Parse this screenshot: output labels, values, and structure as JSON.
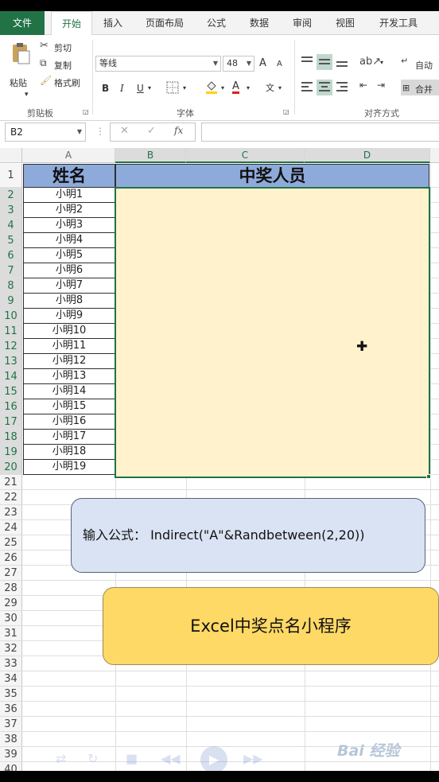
{
  "tabs": [
    "文件",
    "开始",
    "插入",
    "页面布局",
    "公式",
    "数据",
    "审阅",
    "视图",
    "开发工具"
  ],
  "ribbon": {
    "paste": "粘贴",
    "cut": "剪切",
    "copy": "复制",
    "format_painter": "格式刷",
    "clipboard_group": "剪贴板",
    "font_name": "等线",
    "font_size": "48",
    "font_group": "字体",
    "bold": "B",
    "italic": "I",
    "underline": "U",
    "font_color": "A",
    "grow_font": "A",
    "shrink_font": "A",
    "phonetic": "文",
    "align_group": "对齐方式",
    "wrap": "自动",
    "merge": "合并"
  },
  "formula_bar": {
    "name_box": "B2",
    "fx": "fx",
    "formula": ""
  },
  "columns": [
    "A",
    "B",
    "C",
    "D"
  ],
  "rows": [
    "1",
    "2",
    "3",
    "4",
    "5",
    "6",
    "7",
    "8",
    "9",
    "10",
    "11",
    "12",
    "13",
    "14",
    "15",
    "16",
    "17",
    "18",
    "19",
    "20",
    "21",
    "22",
    "23",
    "24",
    "25",
    "26",
    "27",
    "28",
    "29",
    "30",
    "31",
    "32",
    "33",
    "34",
    "35",
    "36",
    "37",
    "38",
    "39",
    "40"
  ],
  "sheet": {
    "header_name": "姓名",
    "header_winner": "中奖人员",
    "names": [
      "小明1",
      "小明2",
      "小明3",
      "小明4",
      "小明5",
      "小明6",
      "小明7",
      "小明8",
      "小明9",
      "小明10",
      "小明11",
      "小明12",
      "小明13",
      "小明14",
      "小明15",
      "小明16",
      "小明17",
      "小明18",
      "小明19"
    ]
  },
  "callouts": {
    "formula_hint": "输入公式：  Indirect(\"A\"&Randbetween(2,20))",
    "title": "Excel中奖点名小程序"
  },
  "watermark": "Bai 经验",
  "colors": {
    "excel_green": "#217346",
    "header_blue": "#8eaadb",
    "winner_fill": "#fff2cc",
    "callout_blue": "#dae3f3",
    "callout_yellow": "#ffd966"
  }
}
